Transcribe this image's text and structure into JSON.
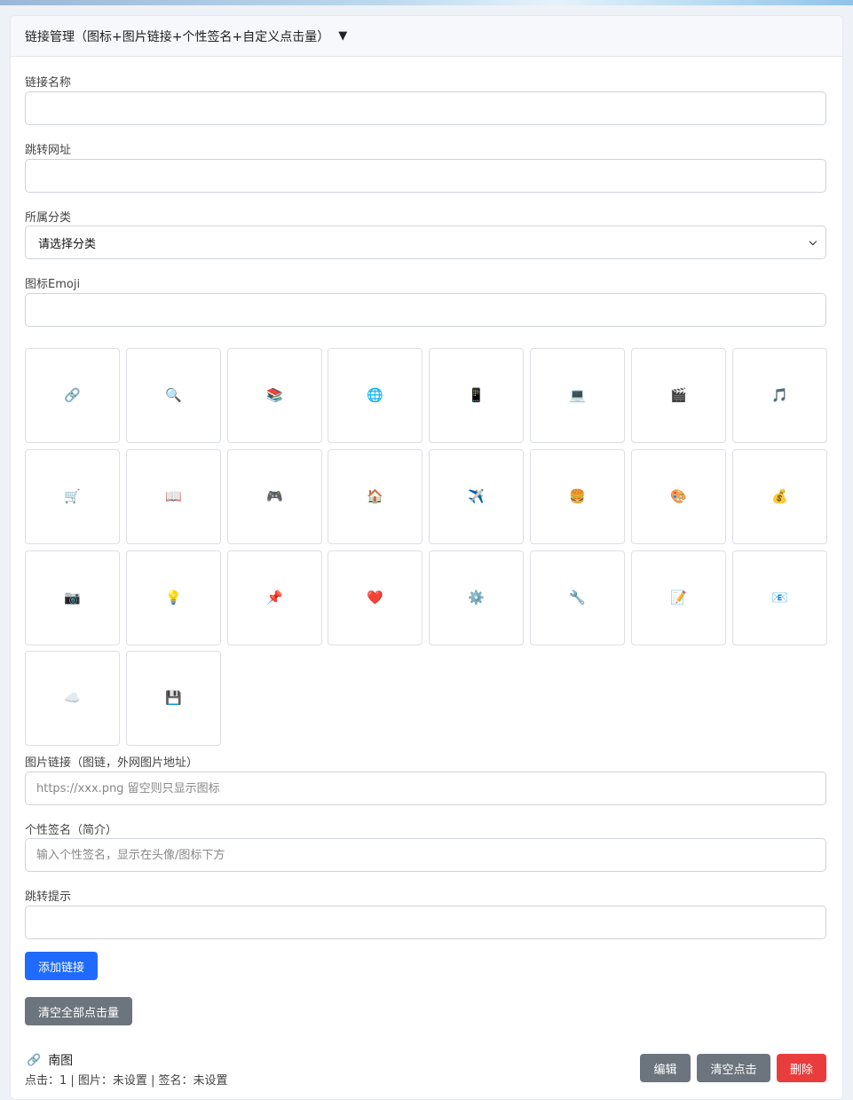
{
  "header": {
    "title": "链接管理（图标+图片链接+个性签名+自定义点击量）",
    "toggle": "▼"
  },
  "form": {
    "name_label": "链接名称",
    "name_value": "",
    "url_label": "跳转网址",
    "url_value": "",
    "category_label": "所属分类",
    "category_selected": "请选择分类",
    "emoji_label": "图标Emoji",
    "emoji_value": "",
    "emojis": [
      "🔗",
      "🔍",
      "📚",
      "🌐",
      "📱",
      "💻",
      "🎬",
      "🎵",
      "🛒",
      "📖",
      "🎮",
      "🏠",
      "✈️",
      "🍔",
      "🎨",
      "💰",
      "📷",
      "💡",
      "📌",
      "❤️",
      "⚙️",
      "🔧",
      "📝",
      "📧",
      "☁️",
      "💾"
    ],
    "image_label": "图片链接（图链，外网图片地址）",
    "image_placeholder": "https://xxx.png 留空则只显示图标",
    "sign_label": "个性签名（简介）",
    "sign_placeholder": "输入个性签名，显示在头像/图标下方",
    "tip_label": "跳转提示",
    "tip_value": "",
    "add_button": "添加链接",
    "clear_all_button": "清空全部点击量"
  },
  "links": [
    {
      "icon": "🔗",
      "name": "南图",
      "meta": "点击：1 | 图片：未设置 | 签名：未设置",
      "edit": "编辑",
      "clear": "清空点击",
      "delete": "删除"
    }
  ]
}
